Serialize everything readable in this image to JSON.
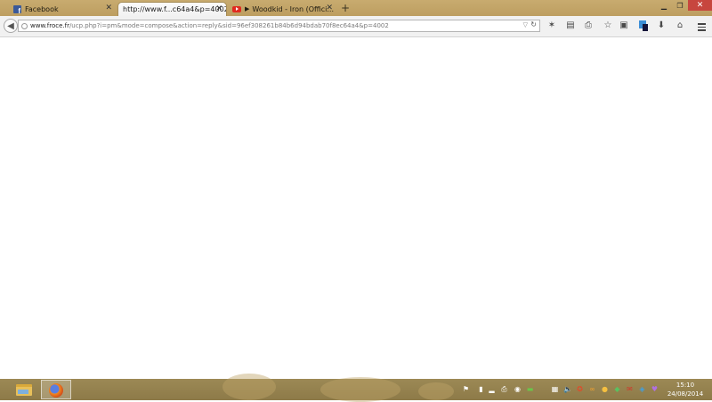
{
  "browser": {
    "tabs": [
      {
        "title": "Facebook",
        "active": false,
        "favicon": "facebook-icon"
      },
      {
        "title": "http://www.f...c64a4&p=4002",
        "active": true,
        "favicon": "none"
      },
      {
        "title": "Woodkid - Iron (Offici...",
        "active": false,
        "favicon": "youtube-icon",
        "playing": true
      }
    ],
    "new_tab_label": "+",
    "url": {
      "domain": "www.froce.fr",
      "rest": "/ucp.php?i=pm&mode=compose&action=reply&sid=96ef308261b84b6d94bdab70f8ec64a4&p=4002"
    }
  },
  "toolbar_icons": [
    "bookmark-star-addon-icon",
    "reader-icon",
    "print-icon",
    "bookmark-star-icon",
    "clipboard-icon",
    "addon-icon",
    "download-icon",
    "home-icon",
    "menu-icon"
  ],
  "taskbar": {
    "apps": [
      "file-explorer-icon",
      "firefox-icon"
    ],
    "clock": {
      "time": "15:10",
      "date": "24/08/2014"
    }
  },
  "colors": {
    "chrome_accent": "#c8ab6f",
    "taskbar": "#9c8955",
    "close_button": "#c7463e"
  }
}
